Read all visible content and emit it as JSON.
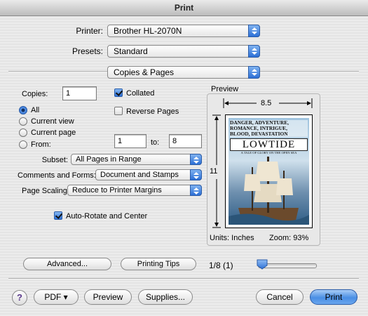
{
  "window": {
    "title": "Print"
  },
  "printer": {
    "label": "Printer:",
    "value": "Brother HL-2070N"
  },
  "presets": {
    "label": "Presets:",
    "value": "Standard"
  },
  "panel": {
    "value": "Copies & Pages"
  },
  "copies": {
    "label": "Copies:",
    "value": "1",
    "collated_label": "Collated",
    "collated": true,
    "reverse_label": "Reverse Pages",
    "reverse": false
  },
  "pages": {
    "all": "All",
    "current_view": "Current view",
    "current_page": "Current page",
    "from": "From:",
    "to": "to:",
    "from_value": "1",
    "to_value": "8",
    "selected": "All"
  },
  "subset": {
    "label": "Subset:",
    "value": "All Pages in Range"
  },
  "comments": {
    "label": "Comments and Forms:",
    "value": "Document and Stamps"
  },
  "scaling": {
    "label": "Page Scaling:",
    "value": "Reduce to Printer Margins"
  },
  "autorotate": {
    "label": "Auto-Rotate and Center",
    "checked": true
  },
  "preview": {
    "title": "Preview",
    "width": "8.5",
    "height": "11",
    "units": "Units: Inches",
    "zoom": "Zoom:  93%",
    "doc_line1": "DANGER, ADVENTURE,",
    "doc_line2": "ROMANCE, INTRIGUE,",
    "doc_line3": "BLOOD, DEVASTATION",
    "doc_title": "LOWTIDE",
    "doc_sub": "A TALE OF GLORY ON THE OPEN SEA"
  },
  "nav": {
    "advanced": "Advanced...",
    "tips": "Printing Tips",
    "page_indicator": "1/8 (1)",
    "slider_position": 0.0
  },
  "footer": {
    "help": "?",
    "pdf": "PDF ▾",
    "preview": "Preview",
    "supplies": "Supplies...",
    "cancel": "Cancel",
    "print": "Print"
  }
}
